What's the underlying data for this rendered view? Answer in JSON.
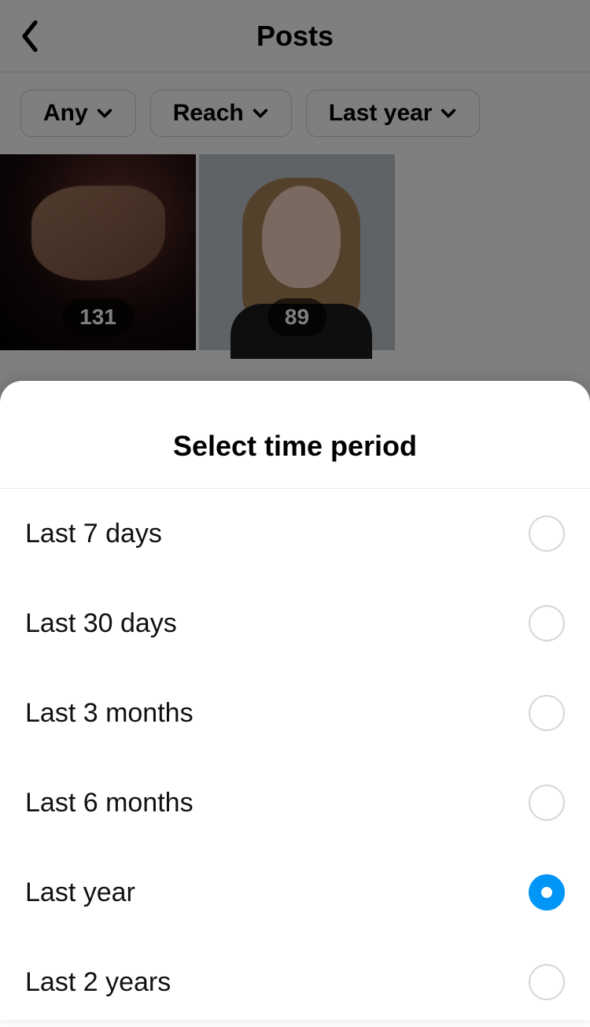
{
  "header": {
    "title": "Posts"
  },
  "filters": {
    "type": "Any",
    "metric": "Reach",
    "period": "Last year"
  },
  "posts": [
    {
      "count": "131"
    },
    {
      "count": "89"
    }
  ],
  "sheet": {
    "title": "Select time period",
    "options": [
      {
        "label": "Last 7 days",
        "selected": false
      },
      {
        "label": "Last 30 days",
        "selected": false
      },
      {
        "label": "Last 3 months",
        "selected": false
      },
      {
        "label": "Last 6 months",
        "selected": false
      },
      {
        "label": "Last year",
        "selected": true
      },
      {
        "label": "Last 2 years",
        "selected": false
      }
    ]
  }
}
